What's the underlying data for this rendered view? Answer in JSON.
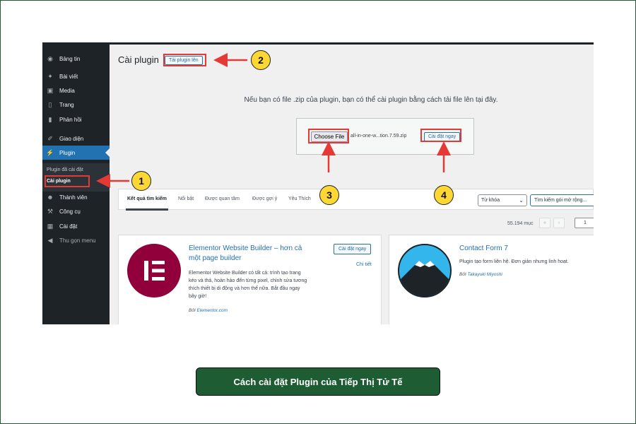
{
  "sidebar": {
    "items": [
      {
        "label": "Bảng tin",
        "icon": "dashboard-icon"
      },
      {
        "label": "Bài viết",
        "icon": "pin-icon"
      },
      {
        "label": "Media",
        "icon": "media-icon"
      },
      {
        "label": "Trang",
        "icon": "page-icon"
      },
      {
        "label": "Phản hồi",
        "icon": "comment-icon"
      },
      {
        "label": "Giao diện",
        "icon": "brush-icon"
      },
      {
        "label": "Plugin",
        "icon": "plugin-icon"
      },
      {
        "label": "Thành viên",
        "icon": "user-icon"
      },
      {
        "label": "Công cụ",
        "icon": "wrench-icon"
      },
      {
        "label": "Cài đặt",
        "icon": "settings-icon"
      },
      {
        "label": "Thu gọn menu",
        "icon": "collapse-icon"
      }
    ],
    "submenu": [
      {
        "label": "Plugin đã cài đặt"
      },
      {
        "label": "Cài plugin"
      }
    ]
  },
  "header": {
    "title": "Cài plugin",
    "upload_button": "Tải plugin lên"
  },
  "upload": {
    "message": "Nếu bạn có file .zip của plugin, bạn có thể cài plugin bằng cách tải file lên tại đây.",
    "choose_file": "Choose File",
    "file_name": "all-in-one-w...tion.7.59.zip",
    "install_now": "Cài đặt ngay"
  },
  "filter": {
    "tabs": [
      "Kết quả tìm kiếm",
      "Nổi bật",
      "Được quan tâm",
      "Được gợi ý",
      "Yêu Thích"
    ],
    "select_value": "Từ khóa",
    "search_value": "Tìm kiếm gói mở rộng..."
  },
  "pagination": {
    "count": "55.194 mục",
    "first": "«",
    "prev": "‹",
    "current_page": "1"
  },
  "plugins": [
    {
      "title_line1": "Elementor Website Builder – hơn cả",
      "title_line2": "một page builder",
      "desc_line1": "Elementor Website Builder có tất cả: trình tạo trang",
      "desc_line2": "kéo và thả, hoàn hảo đến từng pixel, chỉnh sửa tương",
      "desc_line3": "thích thiết bị di động và hơn thế nữa. Bắt đầu ngay",
      "desc_line4": "bây giờ!",
      "author_prefix": "Bởi",
      "author": "Elementor.com",
      "install": "Cài đặt ngay",
      "details": "Chi tiết",
      "icon_color": "#92003b",
      "icon_mark_color": "#ffffff"
    },
    {
      "title": "Contact Form 7",
      "desc": "Plugin tạo form liên hệ. Đơn giản nhưng linh hoạt.",
      "author_prefix": "Bởi",
      "author": "Takayuki Miyoshi",
      "icon_color": "#33b6ec"
    }
  ],
  "callouts": [
    "1",
    "2",
    "3",
    "4"
  ],
  "caption": "Cách cài đặt Plugin của Tiếp Thị Tử Tế",
  "colors": {
    "accent": "#2271b1",
    "highlight": "#e53935",
    "badge": "#fdd835",
    "caption_bg": "#1e5c34",
    "sidebar_bg": "#1d2327"
  }
}
